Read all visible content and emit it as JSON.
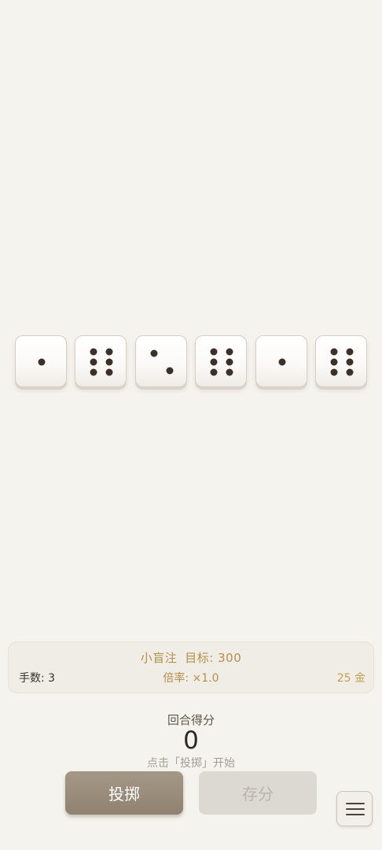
{
  "dice": [
    {
      "value": 1,
      "pips": [
        [
          0.5,
          0.5
        ]
      ]
    },
    {
      "value": 6,
      "pips": [
        [
          0.35,
          0.3
        ],
        [
          0.65,
          0.3
        ],
        [
          0.35,
          0.5
        ],
        [
          0.65,
          0.5
        ],
        [
          0.35,
          0.7
        ],
        [
          0.65,
          0.7
        ]
      ]
    },
    {
      "value": 2,
      "pips": [
        [
          0.35,
          0.33
        ],
        [
          0.65,
          0.67
        ]
      ]
    },
    {
      "value": 6,
      "pips": [
        [
          0.35,
          0.3
        ],
        [
          0.65,
          0.3
        ],
        [
          0.35,
          0.5
        ],
        [
          0.65,
          0.5
        ],
        [
          0.35,
          0.7
        ],
        [
          0.65,
          0.7
        ]
      ]
    },
    {
      "value": 1,
      "pips": [
        [
          0.5,
          0.5
        ]
      ]
    },
    {
      "value": 6,
      "pips": [
        [
          0.35,
          0.3
        ],
        [
          0.65,
          0.3
        ],
        [
          0.35,
          0.5
        ],
        [
          0.65,
          0.5
        ],
        [
          0.35,
          0.7
        ],
        [
          0.65,
          0.7
        ]
      ]
    }
  ],
  "info": {
    "blind": "小盲注",
    "target": "目标: 300",
    "hands": "手数: 3",
    "multiplier": "倍率: ×1.0",
    "gold": "25 金"
  },
  "score": {
    "label": "回合得分",
    "value": "0",
    "hint": "点击「投掷」开始"
  },
  "buttons": {
    "roll": "投掷",
    "save": "存分"
  },
  "menu_icon": "hamburger-menu-icon",
  "colors": {
    "background": "#f5f3ee",
    "accent_gold": "#b4904f",
    "roll_button": "#9a8d7b",
    "save_button_disabled": "#dcd8d2",
    "pip": "#3b302a"
  }
}
